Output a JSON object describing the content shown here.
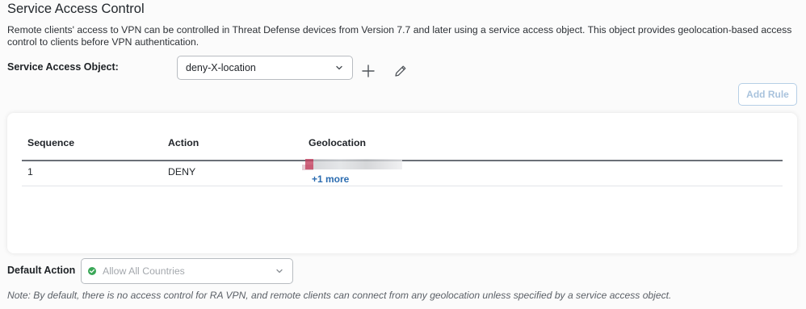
{
  "section": {
    "title": "Service Access Control",
    "description": "Remote clients' access to VPN can be controlled in Threat Defense devices from Version 7.7 and later using a service access object. This object provides geolocation-based access control to clients before VPN authentication."
  },
  "service_access_object": {
    "label": "Service Access Object:",
    "selected": "deny-X-location",
    "icons": {
      "dropdown": "chevron-down-icon",
      "add": "plus-icon",
      "edit": "pencil-icon"
    }
  },
  "toolbar": {
    "add_rule_label": "Add Rule"
  },
  "table": {
    "headers": {
      "sequence": "Sequence",
      "action": "Action",
      "geolocation": "Geolocation"
    },
    "rows": [
      {
        "sequence": "1",
        "action": "DENY",
        "geolocation_more": "+1 more"
      }
    ]
  },
  "default_action": {
    "label": "Default Action",
    "selected": "Allow All Countries",
    "status_color": "#3aa757",
    "icons": {
      "status": "check-circle-icon",
      "dropdown": "chevron-down-icon"
    }
  },
  "note": "Note: By default, there is no access control for RA VPN, and remote clients can connect from any geolocation unless specified by a service access object.",
  "colors": {
    "accent": "#2b6cb0",
    "disabled_button_text": "#a9c3dd",
    "success": "#3aa757"
  }
}
